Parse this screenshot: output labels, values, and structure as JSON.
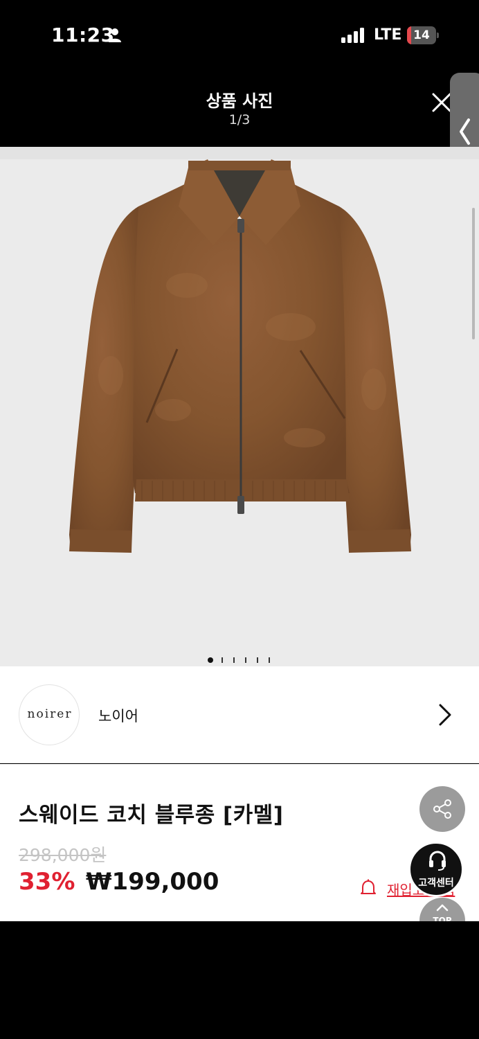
{
  "status_bar": {
    "time": "11:23",
    "network": "LTE",
    "battery": "14",
    "battery_level": 0.14,
    "icons": [
      "person-icon",
      "signal-icon",
      "battery-icon"
    ]
  },
  "header": {
    "title": "상품 사진",
    "counter": "1/3",
    "close_icon": "close-icon"
  },
  "gallery": {
    "image": "brown suede coach jacket",
    "total_dots": 6,
    "active_dot": 0
  },
  "brand": {
    "logo_text": "noirer",
    "name": "노이어",
    "chevron_icon": "chevron-right-icon"
  },
  "product": {
    "name": "스웨이드 코치 블루종 [카멜]",
    "original_price": "298,000원",
    "discount": "33%",
    "price": "₩199,000",
    "restock_label": "재입고 알림",
    "restock_icon": "bell-icon"
  },
  "floating": {
    "share_icon": "share-icon",
    "cs_label": "고객센터",
    "top_label": "TOP"
  },
  "colors": {
    "accent_red": "#e02131",
    "background_dark": "#000000",
    "gallery_bg": "#ebebeb",
    "suede": "#8a5a32"
  }
}
